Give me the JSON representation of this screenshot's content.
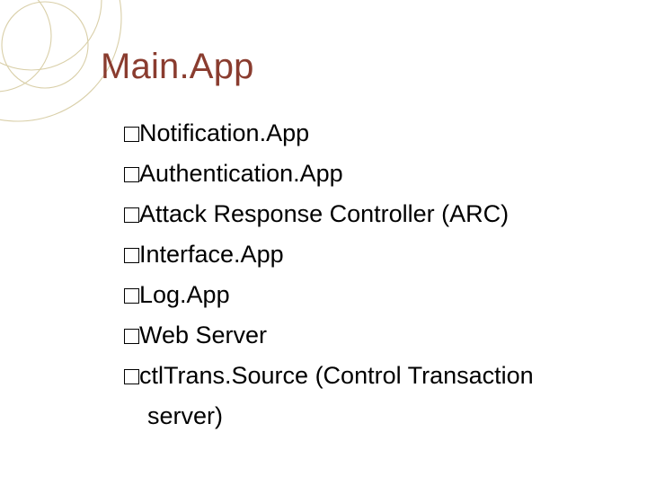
{
  "title": "Main.App",
  "items": [
    {
      "label": "Notification.App"
    },
    {
      "label": "Authentication.App"
    },
    {
      "label": "Attack Response Controller (ARC)"
    },
    {
      "label": "Interface.App"
    },
    {
      "label": "Log.App"
    },
    {
      "label": "Web Server"
    },
    {
      "label": "ctlTrans.Source (Control Transaction"
    }
  ],
  "continuation": "server)"
}
